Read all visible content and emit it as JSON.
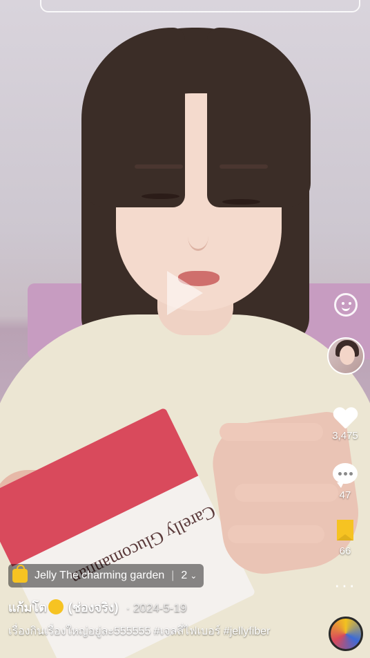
{
  "video": {
    "box_text": "Carelly\nGlucomannan"
  },
  "rail": {
    "likes": "3,475",
    "comments": "47",
    "saves": "66"
  },
  "shop": {
    "label": "Jelly The charming garden",
    "count": "2"
  },
  "post": {
    "author": "แก้มโต",
    "channel_note": "(ช่องจริง)",
    "date": "· 2024-5-19",
    "caption": "เรื่องกินเรื่องใหญ่อยู่ละ555555 #เจลลี่ไฟเบอร์ #jellyfiber"
  }
}
